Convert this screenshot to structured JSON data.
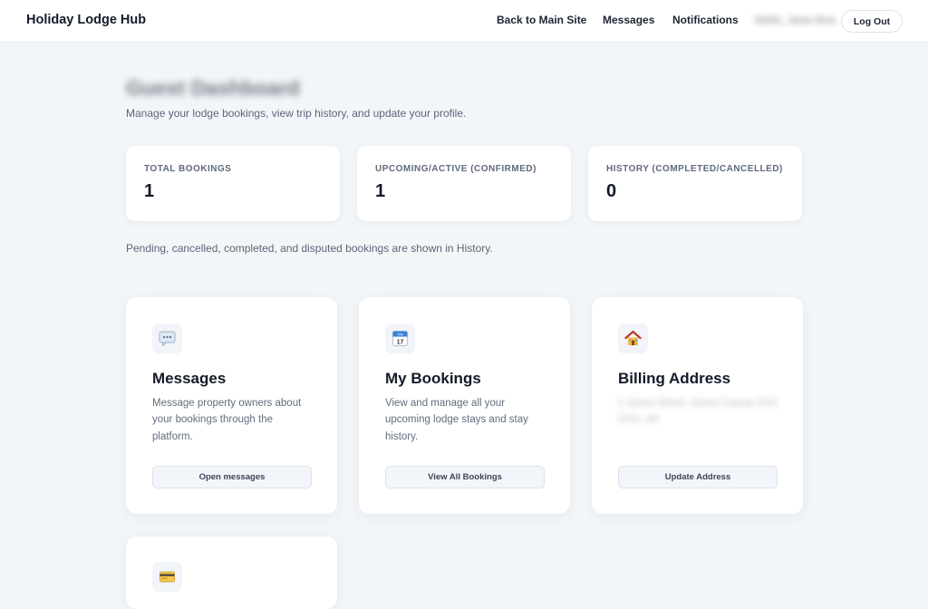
{
  "header": {
    "brand": "Holiday Lodge Hub",
    "nav": {
      "back_to_main": "Back to Main Site",
      "messages": "Messages",
      "notifications": "Notifications",
      "user_name": "Hello, Jane Doe",
      "logout": "Log Out"
    }
  },
  "page": {
    "title": "Guest Dashboard",
    "subtitle": "Manage your lodge bookings, view trip history, and update your profile."
  },
  "stats": [
    {
      "label": "TOTAL BOOKINGS",
      "value": "1"
    },
    {
      "label": "UPCOMING/ACTIVE (CONFIRMED)",
      "value": "1"
    },
    {
      "label": "HISTORY (COMPLETED/CANCELLED)",
      "value": "0"
    }
  ],
  "stats_note": "Pending, cancelled, completed, and disputed bookings are shown in History.",
  "cards": [
    {
      "icon": "speech-bubble-icon",
      "title": "Messages",
      "description": "Message property owners about your bookings through the platform.",
      "button": "Open messages"
    },
    {
      "icon": "calendar-icon",
      "title": "My Bookings",
      "description": "View and manage all your upcoming lodge stays and stay history.",
      "button": "View All Bookings"
    },
    {
      "icon": "house-icon",
      "title": "Billing Address",
      "description": "1 Some Street, Some County XXX XXX, UK",
      "button": "Update Address"
    }
  ],
  "calendar_icon_text": {
    "month": "July",
    "day": "17"
  },
  "partial_card": {
    "icon": "credit-card-icon"
  },
  "colors": {
    "background": "#f3f6f9",
    "card": "#ffffff",
    "text_primary": "#141a28",
    "text_muted": "#626d7e",
    "button_bg": "#f2f5f9"
  }
}
